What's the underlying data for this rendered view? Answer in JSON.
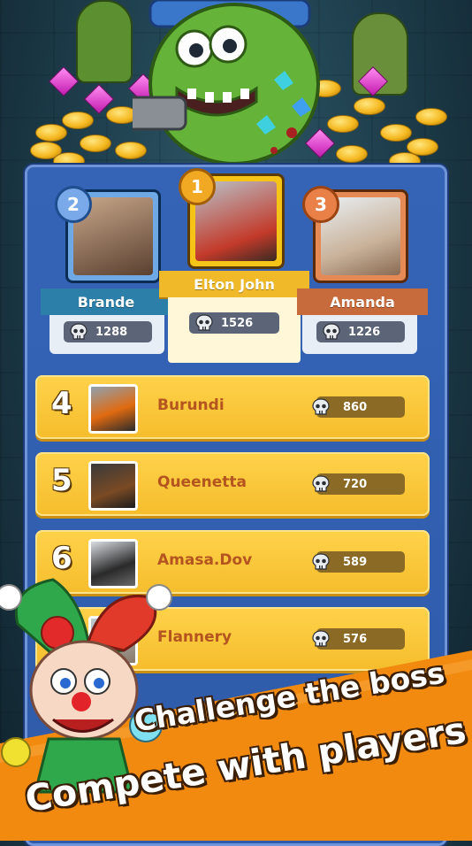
{
  "podium": [
    {
      "rank": "2",
      "name": "Brande",
      "score": "1288",
      "color": "#6ea9e6"
    },
    {
      "rank": "1",
      "name": "Elton John",
      "score": "1526",
      "color": "#f6c417"
    },
    {
      "rank": "3",
      "name": "Amanda",
      "score": "1226",
      "color": "#e58a55"
    }
  ],
  "rows": [
    {
      "rank": "4",
      "name": "Burundi",
      "score": "860"
    },
    {
      "rank": "5",
      "name": "Queenetta",
      "score": "720"
    },
    {
      "rank": "6",
      "name": "Amasa.Dov",
      "score": "589"
    },
    {
      "rank": "",
      "name": "Flannery",
      "score": "576"
    }
  ],
  "promo": {
    "line1": "Challenge the boss",
    "line2": "Compete with players"
  },
  "icons": {
    "score": "skull-icon",
    "badge": "medal-icon"
  },
  "colors": {
    "panel": "#3564b7",
    "row": "#f5bd2c",
    "promo": "#f28a10"
  }
}
